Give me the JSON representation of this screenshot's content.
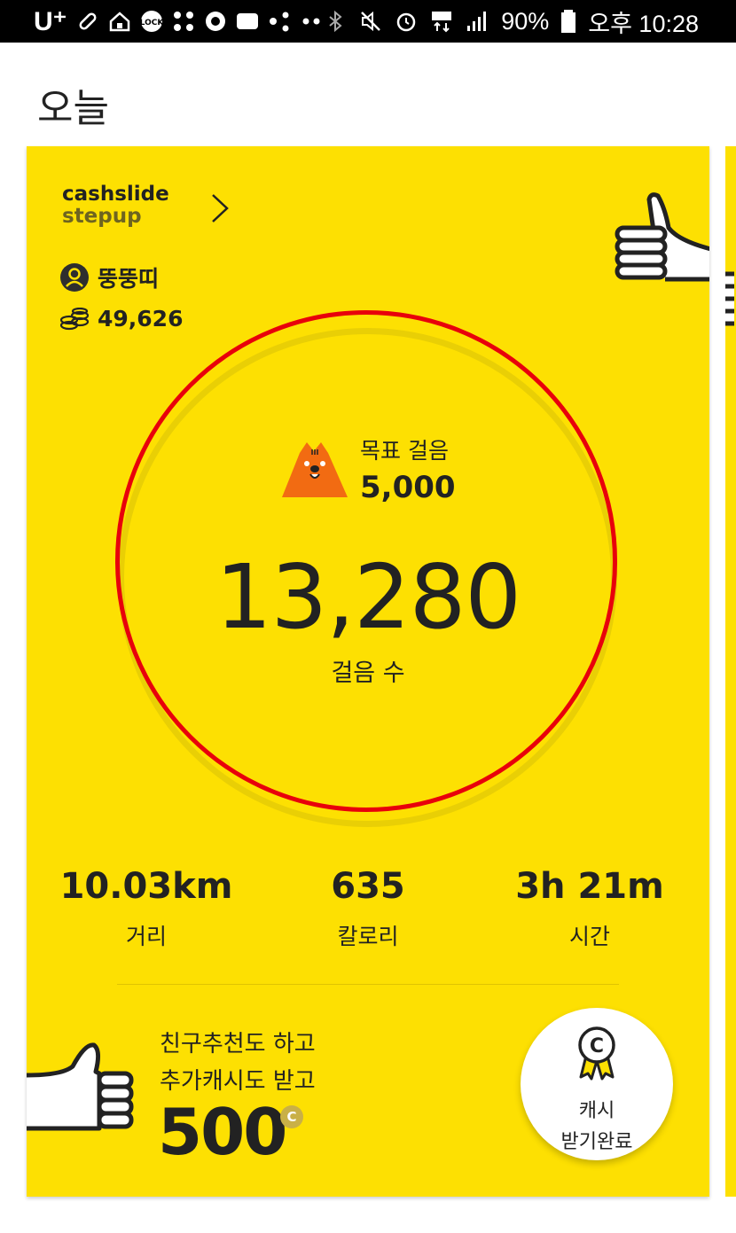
{
  "status_bar": {
    "carrier": "U⁺",
    "battery": "90%",
    "time": "오후 10:28"
  },
  "page": {
    "title": "오늘"
  },
  "card": {
    "brand_line1": "cashslide",
    "brand_line2": "stepup",
    "username": "뚱뚱띠",
    "coins": "49,626",
    "goal_label": "목표 걸음",
    "goal_value": "5,000",
    "steps_value": "13,280",
    "steps_label": "걸음 수",
    "stats": [
      {
        "value": "10.03km",
        "label": "거리"
      },
      {
        "value": "635",
        "label": "칼로리"
      },
      {
        "value": "3h 21m",
        "label": "시간"
      }
    ],
    "promo_line1": "친구추천도 하고",
    "promo_line2": "추가캐시도 받고",
    "promo_amount": "500",
    "promo_badge": "C",
    "cash_button_line1": "캐시",
    "cash_button_line2": "받기완료"
  },
  "colors": {
    "card_bg": "#fde002",
    "ring_highlight": "#e8000b",
    "mascot": "#f26b12"
  }
}
